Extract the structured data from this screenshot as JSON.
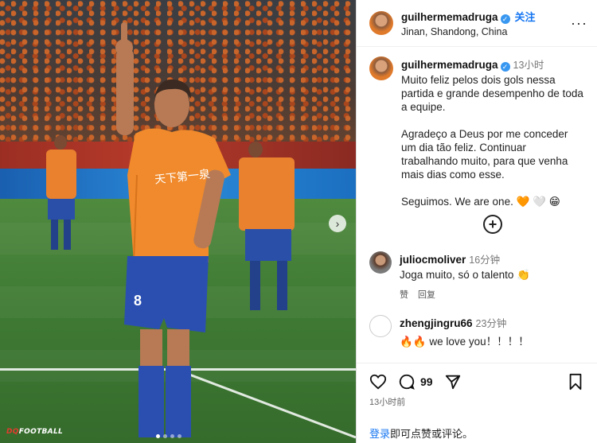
{
  "header": {
    "username": "guilhermemadruga",
    "follow_label": "关注",
    "location": "Jinan, Shandong, China"
  },
  "post": {
    "username": "guilhermemadruga",
    "time": "13小时",
    "caption": "Muito feliz pelos dois gols nessa partida e grande desempenho de toda a equipe.\n\nAgradeço a Deus por me conceder um dia tão feliz. Continuar trabalhando muito, para que venha mais dias como esse.\n\nSeguimos. We are one. 🧡 🤍 😁"
  },
  "comments": [
    {
      "username": "juliocmoliver",
      "time": "16分钟",
      "text": "Joga muito, só o talento 👏",
      "like_label": "赞",
      "reply_label": "回复"
    },
    {
      "username": "zhengjingru66",
      "time": "23分钟",
      "text": "🔥🔥 we love you！！！！"
    }
  ],
  "footer": {
    "comment_count": "99",
    "timestamp": "13小时前",
    "login_link": "登录",
    "login_text": "即可点赞或评论。"
  },
  "photo": {
    "watermark_prefix": "DQ",
    "watermark_text": "FOOTBALL",
    "jersey_number": "8",
    "jersey_text": "天下第一泉"
  },
  "colors": {
    "accent": "#1877f2",
    "verified": "#3897f0",
    "shirt": "#f08a2c",
    "shorts": "#2a4fb0"
  },
  "icons": [
    "verified-icon",
    "more-icon",
    "add-icon",
    "heart-icon",
    "comment-icon",
    "share-icon",
    "bookmark-icon",
    "next-arrow-icon"
  ]
}
